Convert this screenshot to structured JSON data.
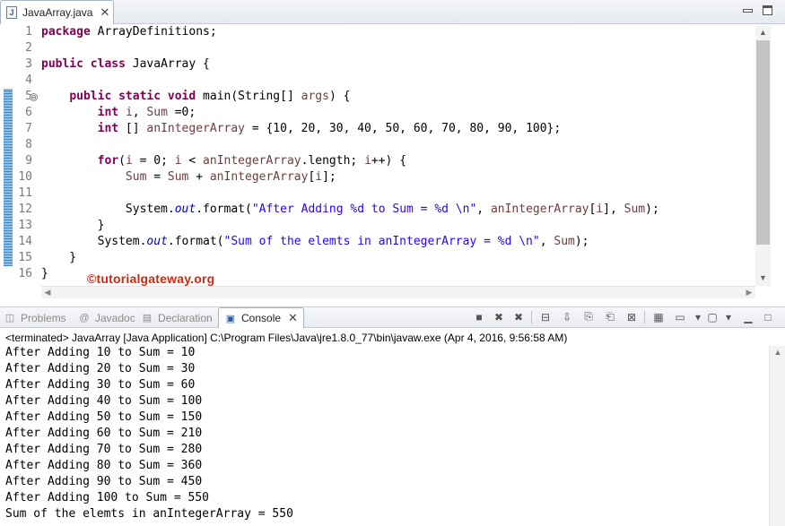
{
  "editor": {
    "tab_label": "JavaArray.java",
    "tab_icon": "java-file-icon",
    "line_numbers": [
      "1",
      "2",
      "3",
      "4",
      "5",
      "6",
      "7",
      "8",
      "9",
      "10",
      "11",
      "12",
      "13",
      "14",
      "15",
      "16"
    ],
    "lines": [
      [
        {
          "t": "package",
          "c": "kw"
        },
        {
          "t": " ArrayDefinitions;"
        }
      ],
      [],
      [
        {
          "t": "public",
          "c": "kw"
        },
        {
          "t": " "
        },
        {
          "t": "class",
          "c": "kw"
        },
        {
          "t": " JavaArray {"
        }
      ],
      [],
      [
        {
          "t": "    "
        },
        {
          "t": "public",
          "c": "kw"
        },
        {
          "t": " "
        },
        {
          "t": "static",
          "c": "kw"
        },
        {
          "t": " "
        },
        {
          "t": "void",
          "c": "kw"
        },
        {
          "t": " main(String[] "
        },
        {
          "t": "args",
          "c": "var"
        },
        {
          "t": ") {"
        }
      ],
      [
        {
          "t": "        "
        },
        {
          "t": "int",
          "c": "kw"
        },
        {
          "t": " "
        },
        {
          "t": "i",
          "c": "var"
        },
        {
          "t": ", "
        },
        {
          "t": "Sum",
          "c": "var"
        },
        {
          "t": " =0;"
        }
      ],
      [
        {
          "t": "        "
        },
        {
          "t": "int",
          "c": "kw"
        },
        {
          "t": " [] "
        },
        {
          "t": "anIntegerArray",
          "c": "var"
        },
        {
          "t": " = {10, 20, 30, 40, 50, 60, 70, 80, 90, 100};"
        }
      ],
      [],
      [
        {
          "t": "        "
        },
        {
          "t": "for",
          "c": "kw"
        },
        {
          "t": "("
        },
        {
          "t": "i",
          "c": "var"
        },
        {
          "t": " = 0; "
        },
        {
          "t": "i",
          "c": "var"
        },
        {
          "t": " < "
        },
        {
          "t": "anIntegerArray",
          "c": "var"
        },
        {
          "t": ".length; "
        },
        {
          "t": "i",
          "c": "var"
        },
        {
          "t": "++) {"
        }
      ],
      [
        {
          "t": "            "
        },
        {
          "t": "Sum",
          "c": "var"
        },
        {
          "t": " = "
        },
        {
          "t": "Sum",
          "c": "var"
        },
        {
          "t": " + "
        },
        {
          "t": "anIntegerArray",
          "c": "var"
        },
        {
          "t": "["
        },
        {
          "t": "i",
          "c": "var"
        },
        {
          "t": "];"
        }
      ],
      [],
      [
        {
          "t": "            System."
        },
        {
          "t": "out",
          "c": "fld"
        },
        {
          "t": ".format("
        },
        {
          "t": "\"After Adding %d to Sum = %d \\n\"",
          "c": "str"
        },
        {
          "t": ", "
        },
        {
          "t": "anIntegerArray",
          "c": "var"
        },
        {
          "t": "["
        },
        {
          "t": "i",
          "c": "var"
        },
        {
          "t": "], "
        },
        {
          "t": "Sum",
          "c": "var"
        },
        {
          "t": ");"
        }
      ],
      [
        {
          "t": "        }"
        }
      ],
      [
        {
          "t": "        System."
        },
        {
          "t": "out",
          "c": "fld"
        },
        {
          "t": ".format("
        },
        {
          "t": "\"Sum of the elemts in anIntegerArray = %d \\n\"",
          "c": "str"
        },
        {
          "t": ", "
        },
        {
          "t": "Sum",
          "c": "var"
        },
        {
          "t": ");"
        }
      ],
      [
        {
          "t": "    }"
        }
      ],
      [
        {
          "t": "}"
        }
      ]
    ],
    "fold_marker": "⊖"
  },
  "watermark": "©tutorialgateway.org",
  "views": {
    "tabs": [
      {
        "label": "Problems",
        "icon": "problems-icon",
        "active": false
      },
      {
        "label": "Javadoc",
        "icon": "javadoc-icon",
        "active": false
      },
      {
        "label": "Declaration",
        "icon": "declaration-icon",
        "active": false
      },
      {
        "label": "Console",
        "icon": "console-icon",
        "active": true
      }
    ],
    "toolbar_icons": [
      "terminate-icon",
      "remove-launch-icon",
      "remove-all-terminated-icon",
      "clear-console-icon",
      "scroll-lock-icon",
      "show-on-output-icon",
      "show-on-error-icon",
      "pin-console-icon",
      "display-console-icon",
      "open-console-icon",
      "minimize-icon",
      "maximize-icon"
    ]
  },
  "console": {
    "label": "<terminated> JavaArray [Java Application] C:\\Program Files\\Java\\jre1.8.0_77\\bin\\javaw.exe (Apr 4, 2016, 9:56:58 AM)",
    "output": [
      "After Adding 10 to Sum = 10",
      "After Adding 20 to Sum = 30",
      "After Adding 30 to Sum = 60",
      "After Adding 40 to Sum = 100",
      "After Adding 50 to Sum = 150",
      "After Adding 60 to Sum = 210",
      "After Adding 70 to Sum = 280",
      "After Adding 80 to Sum = 360",
      "After Adding 90 to Sum = 450",
      "After Adding 100 to Sum = 550",
      "Sum of the elemts in anIntegerArray = 550"
    ]
  },
  "colors": {
    "keyword": "#7f0055",
    "string": "#2a00ff",
    "static_field": "#0000c0",
    "local_variable": "#6a3e3e",
    "watermark": "#d0290f"
  }
}
